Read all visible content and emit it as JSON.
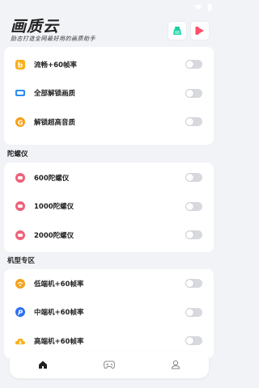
{
  "header": {
    "title": "画质云",
    "subtitle": "励志打造全网最好用的画质助手"
  },
  "sections": [
    {
      "title": "",
      "items": [
        {
          "label": "流畅+60帧率",
          "icon": "b-badge-icon",
          "enabled": false
        },
        {
          "label": "全部解锁画质",
          "icon": "box-icon",
          "enabled": false
        },
        {
          "label": "解锁超高音质",
          "icon": "g-coin-icon",
          "enabled": false
        }
      ]
    },
    {
      "title": "陀螺仪",
      "items": [
        {
          "label": "600陀螺仪",
          "icon": "gyro-icon",
          "enabled": false
        },
        {
          "label": "1000陀螺仪",
          "icon": "gyro-icon",
          "enabled": false
        },
        {
          "label": "2000陀螺仪",
          "icon": "gyro-icon",
          "enabled": false
        }
      ]
    },
    {
      "title": "机型专区",
      "items": [
        {
          "label": "低端机+60帧率",
          "icon": "wifi-badge-icon",
          "enabled": false
        },
        {
          "label": "中端机+60帧率",
          "icon": "p-badge-icon",
          "enabled": false
        },
        {
          "label": "高端机+60帧率",
          "icon": "cloud-icon",
          "enabled": false
        }
      ]
    }
  ],
  "nav": [
    "home-icon",
    "gamepad-icon",
    "profile-icon"
  ],
  "colors": {
    "background": "#f2f3f7",
    "toggle_off": "#d7d9de",
    "accent_orange": "#f7a21b",
    "accent_pink": "#f0607a",
    "accent_blue": "#2f8cf0",
    "accent_green": "#27c28a"
  }
}
